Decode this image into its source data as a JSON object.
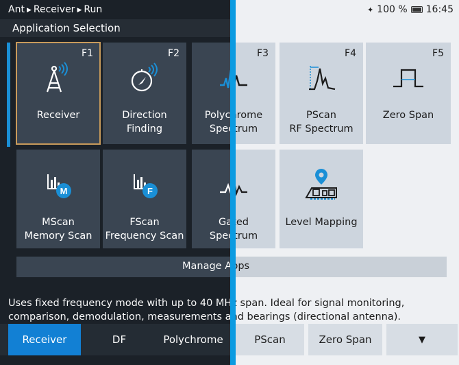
{
  "status_bar": {
    "breadcrumb": [
      "Ant",
      "Receiver",
      "Run"
    ],
    "battery": "100 %",
    "time": "16:45"
  },
  "section_title": "Application Selection",
  "tiles": [
    {
      "fkey": "F1",
      "line1": "Receiver",
      "line2": "",
      "icon": "antenna-icon"
    },
    {
      "fkey": "F2",
      "line1": "Direction",
      "line2": "Finding",
      "icon": "compass-icon"
    },
    {
      "fkey": "F3",
      "line1": "Polychrome",
      "line2": "Spectrum",
      "icon": "polychrome-spectrum-icon"
    },
    {
      "fkey": "F4",
      "line1": "PScan",
      "line2": "RF Spectrum",
      "icon": "pscan-spectrum-icon"
    },
    {
      "fkey": "F5",
      "line1": "Zero Span",
      "line2": "",
      "icon": "zero-span-icon"
    },
    {
      "fkey": "",
      "line1": "MScan",
      "line2": "Memory Scan",
      "icon": "mscan-icon"
    },
    {
      "fkey": "",
      "line1": "FScan",
      "line2": "Frequency Scan",
      "icon": "fscan-icon"
    },
    {
      "fkey": "",
      "line1": "Gated",
      "line2": "Spectrum",
      "icon": "gated-spectrum-icon"
    },
    {
      "fkey": "",
      "line1": "Level Mapping",
      "line2": "",
      "icon": "level-mapping-icon"
    }
  ],
  "manage_apps": "Manage Apps",
  "description": {
    "line1": "Uses fixed frequency mode with up to 40 MHz span. Ideal for signal monitoring,",
    "line2": "comparison, demodulation, measurements and bearings (directional antenna)."
  },
  "tabs": [
    "Receiver",
    "DF",
    "Polychrome",
    "PScan",
    "Zero Span"
  ],
  "colors": {
    "accent": "#1280d4",
    "divider": "#0b9be1",
    "selection_outline": "#c99b5b",
    "icon_blue": "#1a8fd6"
  }
}
